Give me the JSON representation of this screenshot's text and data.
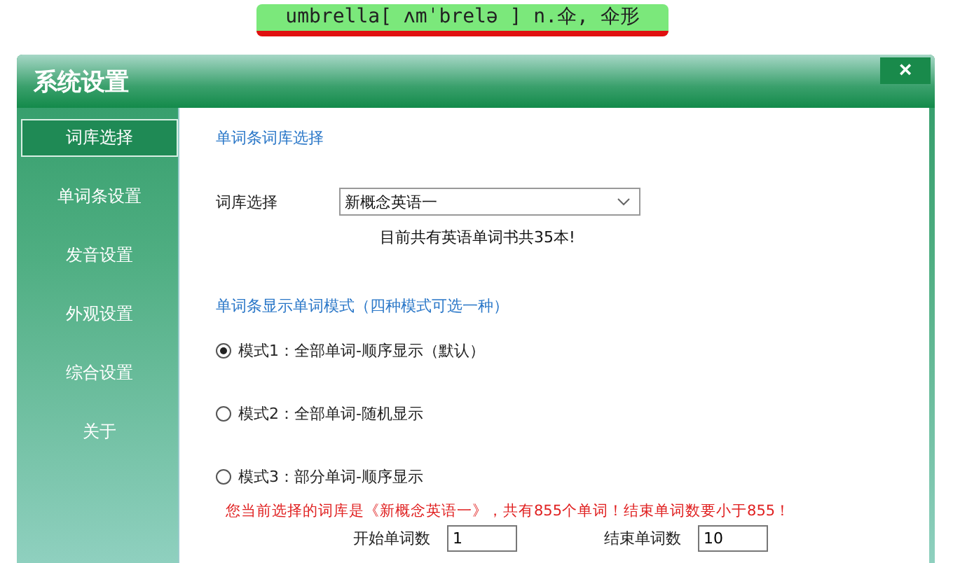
{
  "word_bar": {
    "text": "umbrella[ ʌmˈbrelə ] n.伞, 伞形"
  },
  "window": {
    "title": "系统设置",
    "close": "×"
  },
  "sidebar": {
    "items": [
      {
        "label": "词库选择",
        "selected": true
      },
      {
        "label": "单词条设置",
        "selected": false
      },
      {
        "label": "发音设置",
        "selected": false
      },
      {
        "label": "外观设置",
        "selected": false
      },
      {
        "label": "综合设置",
        "selected": false
      },
      {
        "label": "关于",
        "selected": false
      }
    ]
  },
  "library": {
    "heading": "单词条词库选择",
    "label": "词库选择",
    "value": "新概念英语一",
    "note": "目前共有英语单词书共35本!"
  },
  "modes": {
    "heading": "单词条显示单词模式（四种模式可选一种）",
    "options": [
      {
        "label": "模式1：全部单词-顺序显示（默认）",
        "selected": true
      },
      {
        "label": "模式2：全部单词-随机显示",
        "selected": false
      },
      {
        "label": "模式3：部分单词-顺序显示",
        "selected": false
      }
    ]
  },
  "warning": "您当前选择的词库是《新概念英语一》，共有855个单词！结束单词数要小于855！",
  "range": {
    "start_label": "开始单词数",
    "start_value": "1",
    "end_label": "结束单词数",
    "end_value": "10"
  }
}
